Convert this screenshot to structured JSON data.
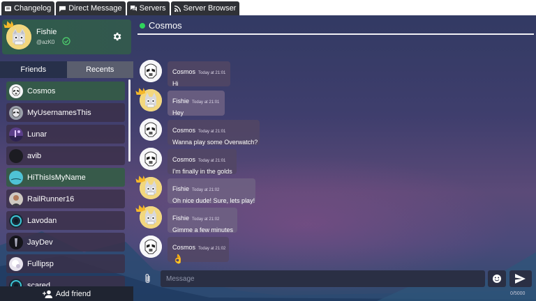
{
  "tabs": [
    {
      "label": "Changelog",
      "icon": "list-icon"
    },
    {
      "label": "Direct Message",
      "icon": "message-icon"
    },
    {
      "label": "Servers",
      "icon": "chat-icon"
    },
    {
      "label": "Server Browser",
      "icon": "rss-icon"
    }
  ],
  "profile": {
    "name": "Fishie",
    "tag": "@azK0",
    "status_icon": "check-circle-icon",
    "settings_icon": "gear-icon"
  },
  "left_tabs": {
    "friends": "Friends",
    "recents": "Recents"
  },
  "friends": [
    {
      "name": "Cosmos",
      "avatar": "stormtrooper",
      "highlight": true
    },
    {
      "name": "MyUsernamesThis",
      "avatar": "trooper-grey",
      "highlight": false
    },
    {
      "name": "Lunar",
      "avatar": "purple-sky",
      "highlight": false
    },
    {
      "name": "avib",
      "avatar": "dark",
      "highlight": false
    },
    {
      "name": "HiThisIsMyName",
      "avatar": "teal",
      "highlight": true
    },
    {
      "name": "RailRunner16",
      "avatar": "person",
      "highlight": false
    },
    {
      "name": "Lavodan",
      "avatar": "ring",
      "highlight": false
    },
    {
      "name": "JayDev",
      "avatar": "dark-figure",
      "highlight": false
    },
    {
      "name": "Fullipsp",
      "avatar": "light",
      "highlight": false
    },
    {
      "name": "scared",
      "avatar": "ring",
      "highlight": false
    }
  ],
  "add_friend": "Add friend",
  "chat": {
    "title": "Cosmos",
    "status_color": "#2fd45c",
    "messages": [
      {
        "author": "Cosmos",
        "time": "Today at 21:01",
        "text": "Hi",
        "me": false
      },
      {
        "author": "Fishie",
        "time": "Today at 21:01",
        "text": "Hey",
        "me": true
      },
      {
        "author": "Cosmos",
        "time": "Today at 21:01",
        "text": "Wanna play some Overwatch?",
        "me": false
      },
      {
        "author": "Cosmos",
        "time": "Today at 21:01",
        "text": "I'm finally in the golds",
        "me": false
      },
      {
        "author": "Fishie",
        "time": "Today at 21:02",
        "text": "Oh nice dude! Sure, lets play!",
        "me": true
      },
      {
        "author": "Fishie",
        "time": "Today at 21:02",
        "text": "Gimme a few minutes",
        "me": true
      },
      {
        "author": "Cosmos",
        "time": "Today at 21:02",
        "text": "👌",
        "me": false
      }
    ],
    "placeholder": "Message",
    "char_count": "0/5000"
  }
}
